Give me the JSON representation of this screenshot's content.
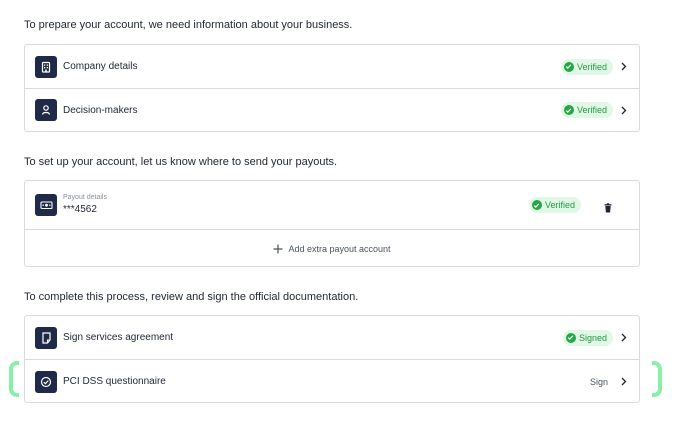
{
  "sections": {
    "business_intro": "To prepare your account, we need information about your business.",
    "payout_intro": "To set up your account, let us know where to send your payouts.",
    "docs_intro": "To complete this process, review and sign the official documentation."
  },
  "business": {
    "company": {
      "label": "Company details",
      "status": "Verified",
      "icon": "building-icon"
    },
    "decision": {
      "label": "Decision-makers",
      "status": "Verified",
      "icon": "person-icon"
    }
  },
  "payout": {
    "caption": "Payout details",
    "account": "***4562",
    "status": "Verified",
    "icon": "banknote-icon",
    "add_label": "Add extra payout account"
  },
  "documents": {
    "agreement": {
      "label": "Sign services agreement",
      "status": "Signed",
      "icon": "document-icon"
    },
    "pci": {
      "label": "PCI DSS questionnaire",
      "action": "Sign",
      "icon": "check-circle-icon"
    }
  },
  "colors": {
    "icon_bg": "#1e2a47",
    "verified_bg": "#e3f7e7",
    "verified_text": "#1e9c41",
    "highlight": "#86f0a6",
    "border": "#d9dbe0"
  }
}
